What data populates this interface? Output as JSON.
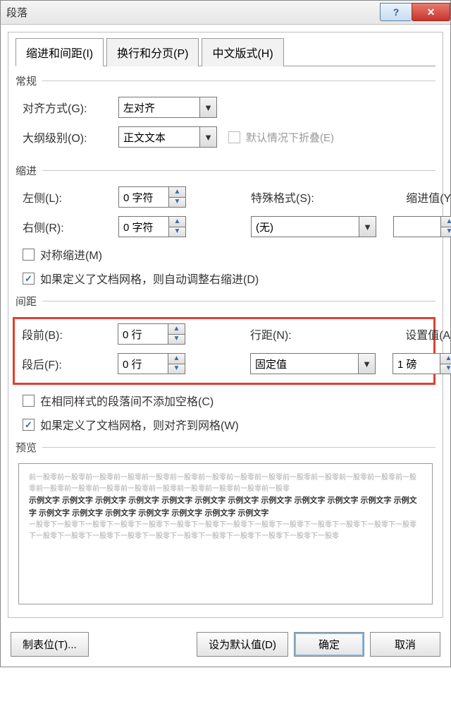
{
  "title": "段落",
  "tabs": [
    "缩进和间距(I)",
    "换行和分页(P)",
    "中文版式(H)"
  ],
  "general": {
    "header": "常规",
    "alignment_label": "对齐方式(G):",
    "alignment_value": "左对齐",
    "outline_label": "大纲级别(O):",
    "outline_value": "正文文本",
    "collapse_label": "默认情况下折叠(E)"
  },
  "indent": {
    "header": "缩进",
    "left_label": "左侧(L):",
    "left_value": "0 字符",
    "right_label": "右侧(R):",
    "right_value": "0 字符",
    "special_label": "特殊格式(S):",
    "special_value": "(无)",
    "indent_by_label": "缩进值(Y):",
    "indent_by_value": "",
    "mirror_label": "对称缩进(M)",
    "grid_label": "如果定义了文档网格，则自动调整右缩进(D)"
  },
  "spacing": {
    "header": "间距",
    "before_label": "段前(B):",
    "before_value": "0 行",
    "after_label": "段后(F):",
    "after_value": "0 行",
    "line_spacing_label": "行距(N):",
    "line_spacing_value": "固定值",
    "at_label": "设置值(A):",
    "at_value": "1 磅",
    "no_space_label": "在相同样式的段落间不添加空格(C)",
    "snap_label": "如果定义了文档网格，则对齐到网格(W)"
  },
  "preview": {
    "header": "预览",
    "gray_before": "前一股零前一股零前一股零前一股零前一股零前一股零前一股零前一股零前一股零前一股零前一股零前一股零前一股零前一股零前一股零前一股零前一股零前一股零前一股零前一股零前一股零前一股零前一股零",
    "sample": "示例文字 示例文字 示例文字 示例文字 示例文字 示例文字 示例文字 示例文字 示例文字 示例文字 示例文字 示例文字 示例文字 示例文字 示例文字 示例文字 示例文字 示例文字 示例文字",
    "gray_after": "一股零下一股零下一股零下一股零下一股零下一股零下一股零下一股零下一股零下一股零下一股零下一股零下一股零下一股零下一股零下一股零下一股零下一股零下一股零下一股零下一股零下一股零下一股零下一股零下一股零"
  },
  "buttons": {
    "tabs": "制表位(T)...",
    "default": "设为默认值(D)",
    "ok": "确定",
    "cancel": "取消"
  }
}
